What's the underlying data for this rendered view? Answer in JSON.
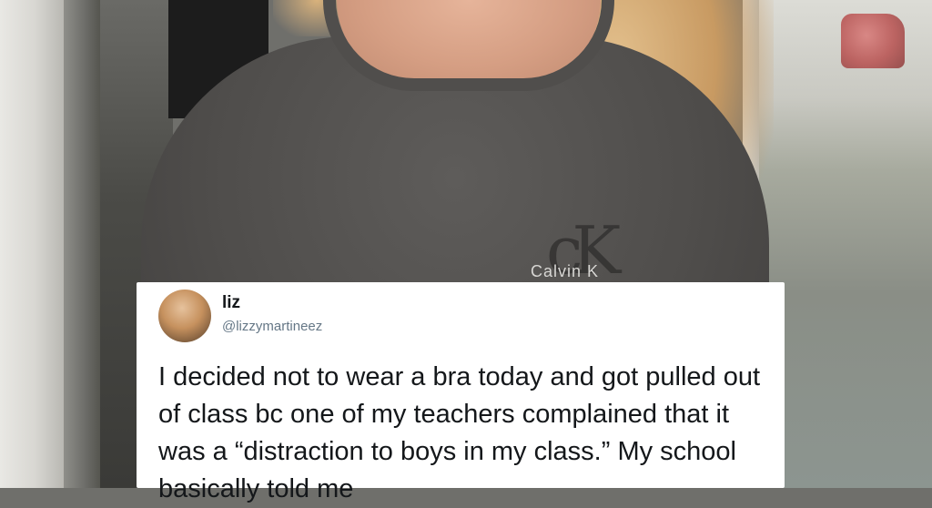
{
  "photo": {
    "shirt_logo": "Calvin K"
  },
  "tweet": {
    "display_name": "liz",
    "handle": "@lizzymartineez",
    "text": "I decided not to wear a bra today and got pulled out of class bc one of my teachers complained that it was a “distraction to boys in my class.” My school basically told me"
  }
}
